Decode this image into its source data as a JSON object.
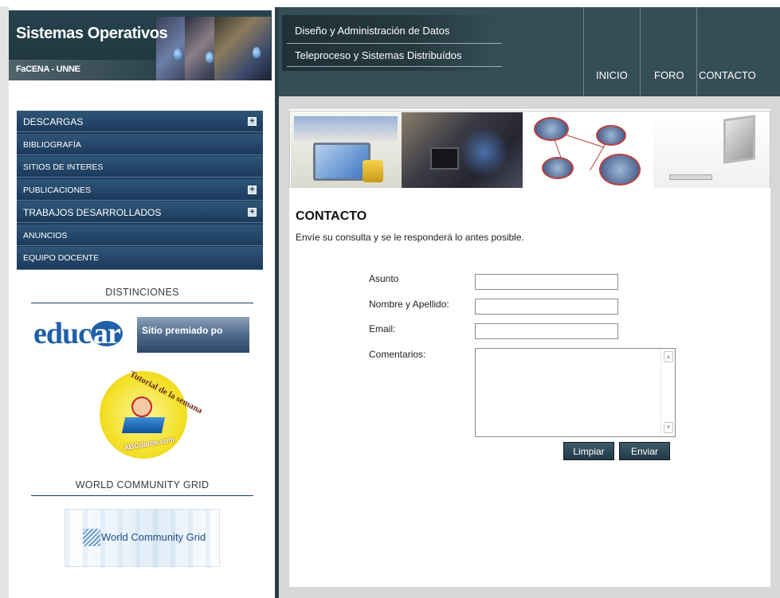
{
  "logo": {
    "title": "Sistemas Operativos",
    "subtitle": "FaCENA - UNNE"
  },
  "sidebar": {
    "menu": [
      {
        "label": "DESCARGAS",
        "expandable": true
      },
      {
        "label": "BIBLIOGRAFÍA",
        "expandable": false
      },
      {
        "label": "SITIOS DE INTERES",
        "expandable": false
      },
      {
        "label": "PUBLICACIONES",
        "expandable": true
      },
      {
        "label": "TRABAJOS DESARROLLADOS",
        "expandable": true
      },
      {
        "label": "ANUNCIOS",
        "expandable": false
      },
      {
        "label": "EQUIPO DOCENTE",
        "expandable": false
      }
    ],
    "distinctions_heading": "DISTINCIONES",
    "educar": {
      "logo_text": "educ",
      "logo_ar": "ar",
      "banner_text": "Sitio premiado po"
    },
    "abc_badge": {
      "top_text": "Tutorial de la semana",
      "bottom_text": "ABCdatos.com"
    },
    "wcg_heading": "WORLD COMMUNITY GRID",
    "wcg_banner_text": "World Community Grid"
  },
  "header": {
    "sub_links": [
      "Diseño y Administración de Datos",
      "Teleproceso y Sistemas Distribuídos"
    ],
    "nav": [
      "INICIO",
      "FORO",
      "CONTACTO"
    ]
  },
  "main": {
    "title": "CONTACTO",
    "intro": "Envíe su consulta y se le responderá lo antes posible.",
    "form": {
      "subject_label": "Asunto",
      "subject_value": "",
      "name_label": "Nombre y Apellido:",
      "name_value": "",
      "email_label": "Email:",
      "email_value": "",
      "comments_label": "Comentarios:",
      "comments_value": "",
      "clear_label": "Limpiar",
      "send_label": "Enviar"
    }
  },
  "colors": {
    "header_bg": "#344d56",
    "menu_bg": "#1b3a5c",
    "button_bg": "#223a46"
  }
}
